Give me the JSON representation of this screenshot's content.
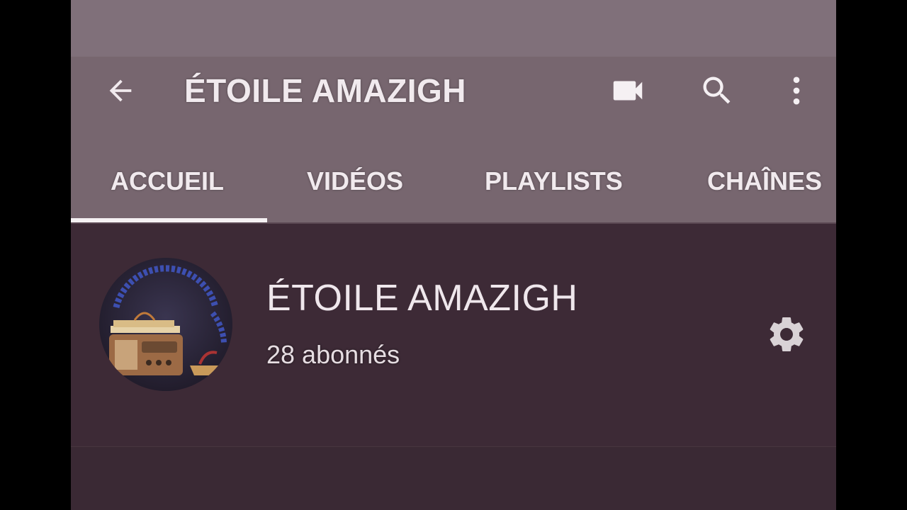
{
  "appbar": {
    "title": "ÉTOILE AMAZIGH",
    "back_icon": "arrow-left-icon",
    "actions": [
      "video-camera-icon",
      "search-icon",
      "more-vert-icon"
    ]
  },
  "tabs": [
    {
      "label": "ACCUEIL",
      "selected": true
    },
    {
      "label": "VIDÉOS",
      "selected": false
    },
    {
      "label": "PLAYLISTS",
      "selected": false
    },
    {
      "label": "CHAÎNES",
      "selected": false
    }
  ],
  "channel": {
    "name": "ÉTOILE AMAZIGH",
    "subscribers": "28 abonnés",
    "avatar_icon": "channel-avatar",
    "settings_icon": "gear-icon"
  },
  "colors": {
    "appbar": "#77666f",
    "header_bg": "#3d2a36",
    "text": "#f1eaee",
    "tab_indicator": "#f5f1f3"
  }
}
